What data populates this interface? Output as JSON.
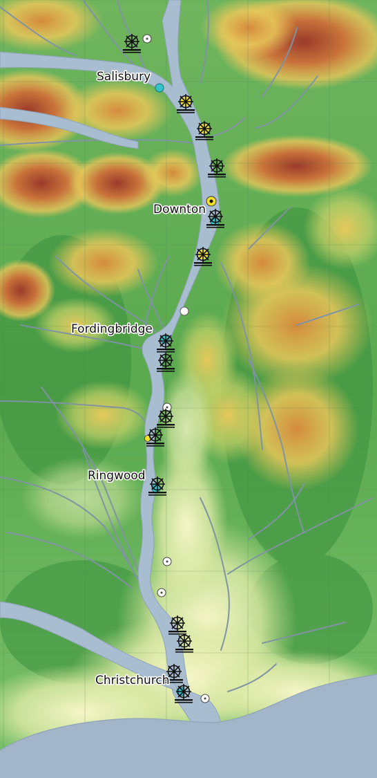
{
  "map": {
    "title": "",
    "towns": [
      {
        "id": "salisbury",
        "name": "Salisbury"
      },
      {
        "id": "downton",
        "name": "Downton"
      },
      {
        "id": "fordingbridge",
        "name": "Fordingbridge"
      },
      {
        "id": "ringwood",
        "name": "Ringwood"
      },
      {
        "id": "christchurch",
        "name": "Christchurch"
      }
    ],
    "legend_colors": {
      "sea": "#a3b5c9",
      "river": "#a9bdd0",
      "lowland": "#f3f3c0",
      "low_green": "#7fc26a",
      "mid_green": "#3f9a3f",
      "upland_yellow": "#e9c85a",
      "upland_orange": "#d08a3a",
      "summit_red": "#a8452e",
      "marker_cyan": "#35c3c8",
      "marker_yellow": "#f2e12a",
      "marker_white": "#ffffff"
    },
    "marker_types": [
      "mill-icon",
      "cyan-circle",
      "yellow-circle",
      "white-circle",
      "target-circle"
    ]
  }
}
